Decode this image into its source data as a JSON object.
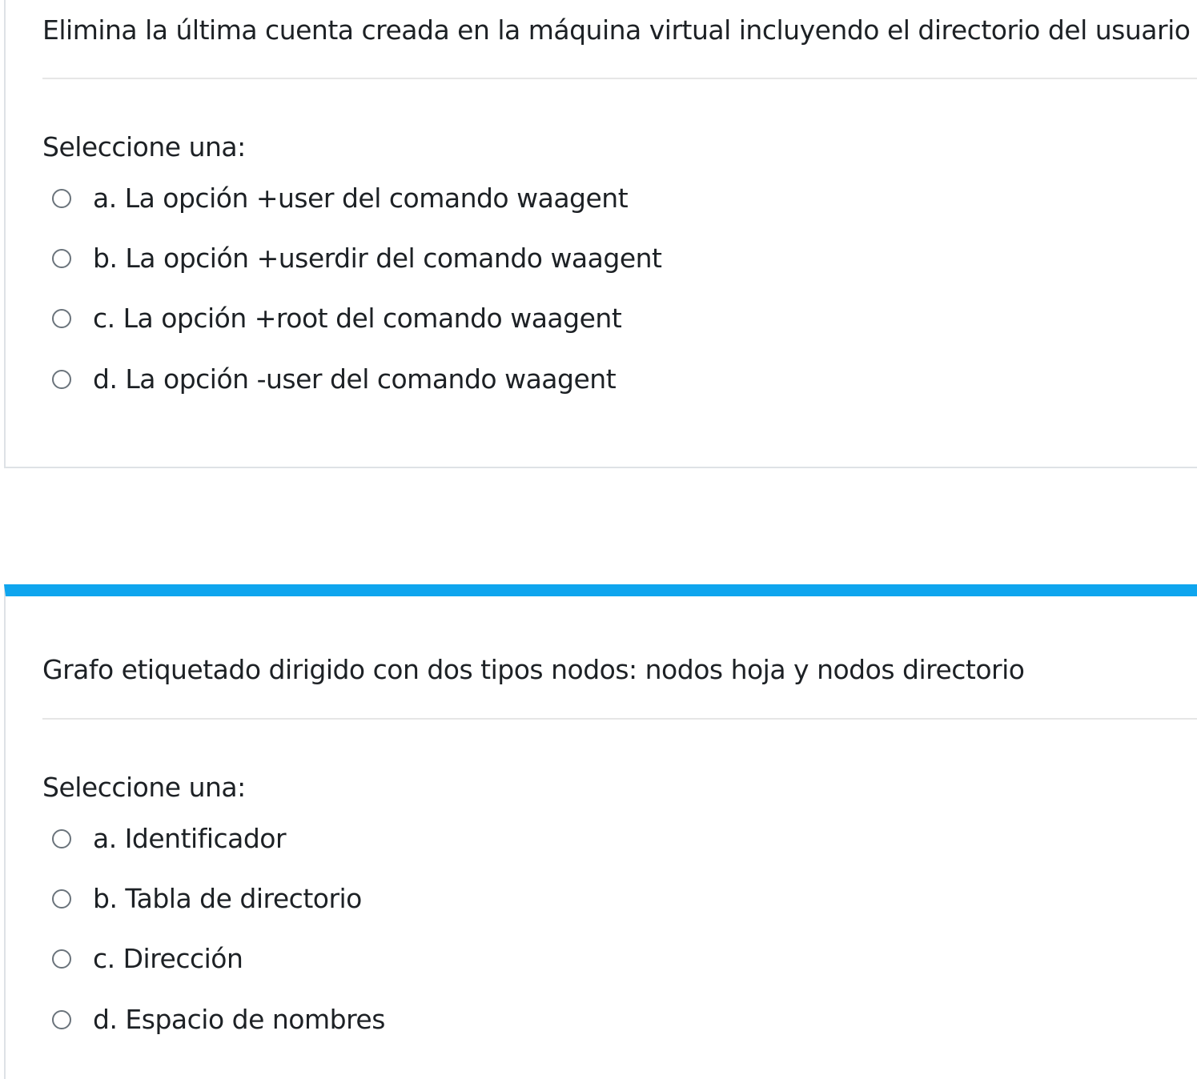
{
  "questions": [
    {
      "text": "Elimina la última cuenta creada en la máquina virtual incluyendo el directorio del usuario",
      "prompt": "Seleccione una:",
      "options": [
        "a. La opción +user del comando waagent",
        "b. La opción +userdir del comando waagent",
        "c. La opción +root del comando waagent",
        "d. La opción -user del comando waagent"
      ]
    },
    {
      "text": "Grafo etiquetado dirigido con dos tipos nodos: nodos hoja y nodos directorio",
      "prompt": "Seleccione una:",
      "options": [
        "a. Identificador",
        "b. Tabla de directorio",
        "c. Dirección",
        "d. Espacio de nombres"
      ]
    }
  ],
  "colors": {
    "accent": "#0fa5ee",
    "border": "#dee2e6",
    "text": "#1d2125",
    "radio_border": "#6a737b"
  }
}
